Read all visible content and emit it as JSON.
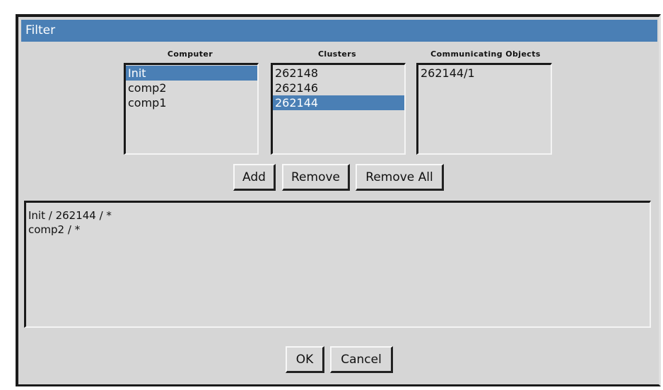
{
  "window": {
    "title": "Filter"
  },
  "columns": {
    "computer": {
      "label": "Computer",
      "items": [
        "Init",
        "comp2",
        "comp1"
      ],
      "selected": "Init"
    },
    "clusters": {
      "label": "Clusters",
      "items": [
        "262148",
        "262146",
        "262144"
      ],
      "selected": "262144"
    },
    "objects": {
      "label": "Communicating Objects",
      "items": [
        "262144/1"
      ],
      "selected": ""
    }
  },
  "buttons": {
    "add": "Add",
    "remove": "Remove",
    "remove_all": "Remove All",
    "ok": "OK",
    "cancel": "Cancel"
  },
  "filters": [
    "Init / 262144 / *",
    "comp2 / *"
  ],
  "colors": {
    "selection": "#4a7fb5",
    "titlebar": "#4a7fb5",
    "background": "#d6d6d6"
  }
}
